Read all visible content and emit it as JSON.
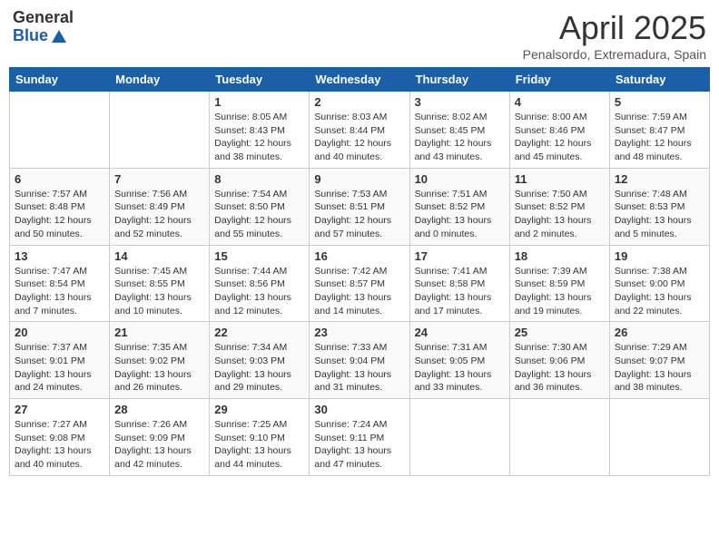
{
  "header": {
    "logo_general": "General",
    "logo_blue": "Blue",
    "month": "April 2025",
    "location": "Penalsordo, Extremadura, Spain"
  },
  "weekdays": [
    "Sunday",
    "Monday",
    "Tuesday",
    "Wednesday",
    "Thursday",
    "Friday",
    "Saturday"
  ],
  "weeks": [
    [
      {
        "day": "",
        "info": ""
      },
      {
        "day": "",
        "info": ""
      },
      {
        "day": "1",
        "info": "Sunrise: 8:05 AM\nSunset: 8:43 PM\nDaylight: 12 hours and 38 minutes."
      },
      {
        "day": "2",
        "info": "Sunrise: 8:03 AM\nSunset: 8:44 PM\nDaylight: 12 hours and 40 minutes."
      },
      {
        "day": "3",
        "info": "Sunrise: 8:02 AM\nSunset: 8:45 PM\nDaylight: 12 hours and 43 minutes."
      },
      {
        "day": "4",
        "info": "Sunrise: 8:00 AM\nSunset: 8:46 PM\nDaylight: 12 hours and 45 minutes."
      },
      {
        "day": "5",
        "info": "Sunrise: 7:59 AM\nSunset: 8:47 PM\nDaylight: 12 hours and 48 minutes."
      }
    ],
    [
      {
        "day": "6",
        "info": "Sunrise: 7:57 AM\nSunset: 8:48 PM\nDaylight: 12 hours and 50 minutes."
      },
      {
        "day": "7",
        "info": "Sunrise: 7:56 AM\nSunset: 8:49 PM\nDaylight: 12 hours and 52 minutes."
      },
      {
        "day": "8",
        "info": "Sunrise: 7:54 AM\nSunset: 8:50 PM\nDaylight: 12 hours and 55 minutes."
      },
      {
        "day": "9",
        "info": "Sunrise: 7:53 AM\nSunset: 8:51 PM\nDaylight: 12 hours and 57 minutes."
      },
      {
        "day": "10",
        "info": "Sunrise: 7:51 AM\nSunset: 8:52 PM\nDaylight: 13 hours and 0 minutes."
      },
      {
        "day": "11",
        "info": "Sunrise: 7:50 AM\nSunset: 8:52 PM\nDaylight: 13 hours and 2 minutes."
      },
      {
        "day": "12",
        "info": "Sunrise: 7:48 AM\nSunset: 8:53 PM\nDaylight: 13 hours and 5 minutes."
      }
    ],
    [
      {
        "day": "13",
        "info": "Sunrise: 7:47 AM\nSunset: 8:54 PM\nDaylight: 13 hours and 7 minutes."
      },
      {
        "day": "14",
        "info": "Sunrise: 7:45 AM\nSunset: 8:55 PM\nDaylight: 13 hours and 10 minutes."
      },
      {
        "day": "15",
        "info": "Sunrise: 7:44 AM\nSunset: 8:56 PM\nDaylight: 13 hours and 12 minutes."
      },
      {
        "day": "16",
        "info": "Sunrise: 7:42 AM\nSunset: 8:57 PM\nDaylight: 13 hours and 14 minutes."
      },
      {
        "day": "17",
        "info": "Sunrise: 7:41 AM\nSunset: 8:58 PM\nDaylight: 13 hours and 17 minutes."
      },
      {
        "day": "18",
        "info": "Sunrise: 7:39 AM\nSunset: 8:59 PM\nDaylight: 13 hours and 19 minutes."
      },
      {
        "day": "19",
        "info": "Sunrise: 7:38 AM\nSunset: 9:00 PM\nDaylight: 13 hours and 22 minutes."
      }
    ],
    [
      {
        "day": "20",
        "info": "Sunrise: 7:37 AM\nSunset: 9:01 PM\nDaylight: 13 hours and 24 minutes."
      },
      {
        "day": "21",
        "info": "Sunrise: 7:35 AM\nSunset: 9:02 PM\nDaylight: 13 hours and 26 minutes."
      },
      {
        "day": "22",
        "info": "Sunrise: 7:34 AM\nSunset: 9:03 PM\nDaylight: 13 hours and 29 minutes."
      },
      {
        "day": "23",
        "info": "Sunrise: 7:33 AM\nSunset: 9:04 PM\nDaylight: 13 hours and 31 minutes."
      },
      {
        "day": "24",
        "info": "Sunrise: 7:31 AM\nSunset: 9:05 PM\nDaylight: 13 hours and 33 minutes."
      },
      {
        "day": "25",
        "info": "Sunrise: 7:30 AM\nSunset: 9:06 PM\nDaylight: 13 hours and 36 minutes."
      },
      {
        "day": "26",
        "info": "Sunrise: 7:29 AM\nSunset: 9:07 PM\nDaylight: 13 hours and 38 minutes."
      }
    ],
    [
      {
        "day": "27",
        "info": "Sunrise: 7:27 AM\nSunset: 9:08 PM\nDaylight: 13 hours and 40 minutes."
      },
      {
        "day": "28",
        "info": "Sunrise: 7:26 AM\nSunset: 9:09 PM\nDaylight: 13 hours and 42 minutes."
      },
      {
        "day": "29",
        "info": "Sunrise: 7:25 AM\nSunset: 9:10 PM\nDaylight: 13 hours and 44 minutes."
      },
      {
        "day": "30",
        "info": "Sunrise: 7:24 AM\nSunset: 9:11 PM\nDaylight: 13 hours and 47 minutes."
      },
      {
        "day": "",
        "info": ""
      },
      {
        "day": "",
        "info": ""
      },
      {
        "day": "",
        "info": ""
      }
    ]
  ]
}
